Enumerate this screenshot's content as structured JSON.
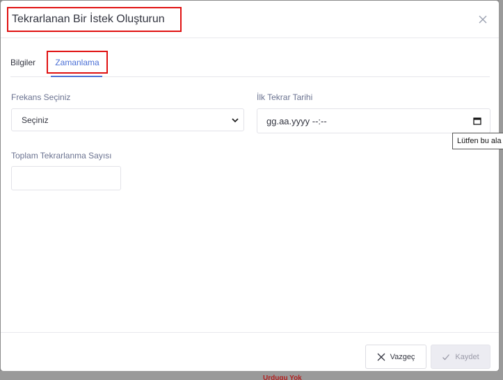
{
  "modal": {
    "title": "Tekrarlanan Bir İstek Oluşturun",
    "close_icon": "close-icon"
  },
  "tabs": [
    {
      "label": "Bilgiler",
      "active": false
    },
    {
      "label": "Zamanlama",
      "active": true
    }
  ],
  "form": {
    "frequency": {
      "label": "Frekans Seçiniz",
      "selected": "Seçiniz"
    },
    "first_date": {
      "label": "İlk Tekrar Tarihi",
      "value": "gg.aa.yyyy --:--",
      "tooltip": "Lütfen bu ala"
    },
    "total_count": {
      "label": "Toplam Tekrarlanma Sayısı",
      "value": ""
    }
  },
  "footer": {
    "cancel_label": "Vazgeç",
    "save_label": "Kaydet"
  },
  "backdrop": {
    "text": "Urdugu Yok"
  },
  "colors": {
    "accent": "#4a6fd6",
    "highlight": "#e01010",
    "label": "#6a7290"
  }
}
